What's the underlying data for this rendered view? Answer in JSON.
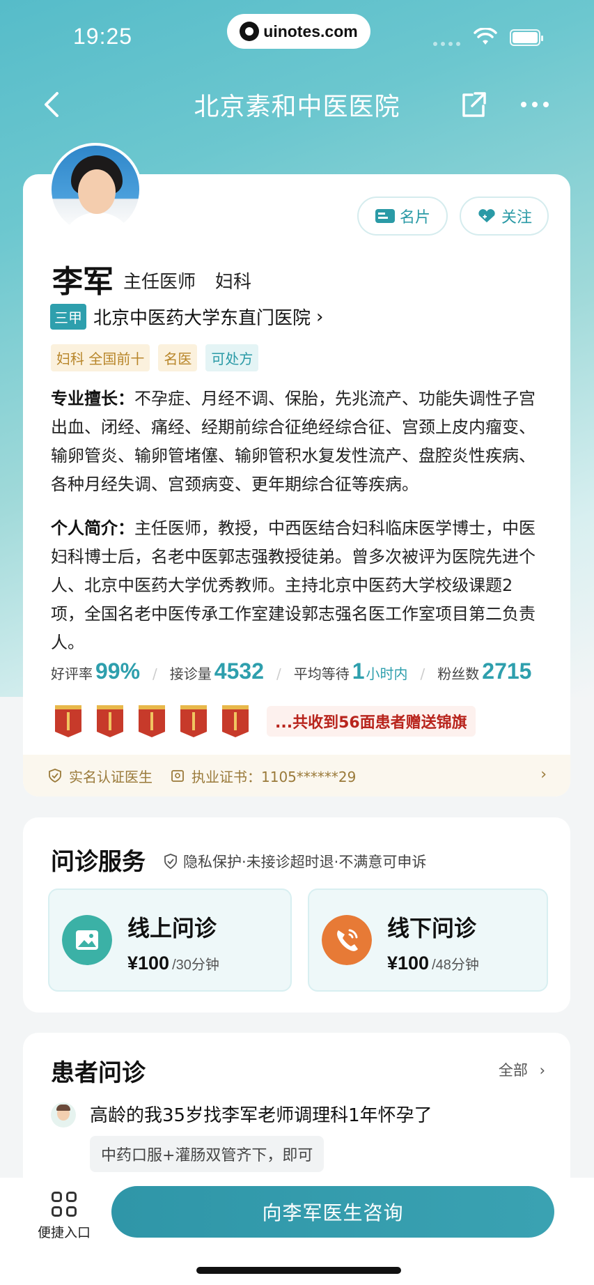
{
  "status_bar": {
    "time": "19:25",
    "url": "uinotes.com"
  },
  "nav": {
    "title": "北京素和中医医院"
  },
  "profile": {
    "card_button_label": "名片",
    "follow_button_label": "关注",
    "name": "李军",
    "title": "主任医师",
    "department": "妇科",
    "hospital_grade": "三甲",
    "hospital_name": "北京中医药大学东直门医院",
    "hospital_chevron": "›",
    "tags": [
      {
        "label": "妇科 全国前十",
        "style": "gold"
      },
      {
        "label": "名医",
        "style": "gold"
      },
      {
        "label": "可处方",
        "style": "teal"
      }
    ],
    "specialty_label": "专业擅长：",
    "specialty_text": "不孕症、月经不调、保胎，先兆流产、功能失调性子宫出血、闭经、痛经、经期前综合征绝经综合征、宫颈上皮内瘤变、输卵管炎、输卵管堵僿、输卵管积水复发性流产、盘腔炎性疾病、各种月经失调、宫颈病变、更年期综合征等疾病。",
    "intro_label": "个人简介：",
    "intro_text": "主任医师，教授，中西医结合妇科临床医学博士，中医妇科博士后，名老中医郭志强教授徒弟。曾多次被评为医院先进个人、北京中医药大学优秀教师。主持北京中医药大学校级课题2项，全国名老中医传承工作室建设郭志强名医工作室项目第二负责人。",
    "stats": {
      "rating_label": "好评率",
      "rating_value": "99%",
      "visits_label": "接诊量",
      "visits_value": "4532",
      "wait_label": "平均等待",
      "wait_value": "1",
      "wait_unit": "小时内",
      "fans_label": "粉丝数",
      "fans_value": "2715"
    },
    "banner_count_icons": 5,
    "banner_note": "...共收到56面患者赠送锦旗",
    "cert": {
      "verified_label": "实名认证医生",
      "license_label": "执业证书：1105******29",
      "chevron": "›"
    }
  },
  "services": {
    "title": "问诊服务",
    "subtitle": "隐私保护·未接诊超时退·不满意可申诉",
    "items": [
      {
        "name": "线上问诊",
        "price": "¥100",
        "per": "/30分钟",
        "icon": "image-chat-icon",
        "color": "#3bb1a6"
      },
      {
        "name": "线下问诊",
        "price": "¥100",
        "per": "/48分钟",
        "icon": "phone-icon",
        "color": "#e77a36"
      }
    ]
  },
  "consultations": {
    "title": "患者问诊",
    "all_label": "全部",
    "all_chevron": "›",
    "question": "高龄的我35岁找李军老师调理科1年怀孕了",
    "answer": "中药口服+灌肠双管齐下，即可"
  },
  "bottom": {
    "quick_label": "便捷入口",
    "cta_label": "向李军医生咨询"
  }
}
